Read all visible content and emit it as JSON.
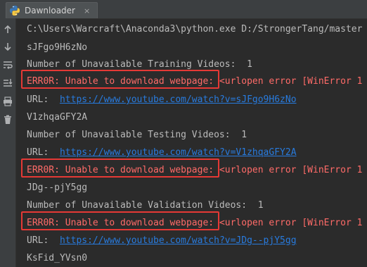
{
  "tab": {
    "title": "Dawnloader",
    "close_glyph": "×",
    "icon": "python-icon"
  },
  "toolbar": {
    "icons": [
      "arrow-up-icon",
      "arrow-down-icon",
      "soft-wrap-icon",
      "scroll-to-end-icon",
      "print-icon",
      "trash-icon"
    ]
  },
  "colors": {
    "background": "#2b2b2b",
    "text": "#bbbbbb",
    "error": "#ff6b68",
    "link": "#287bde",
    "highlight": "#e53935"
  },
  "console": {
    "command": "C:\\Users\\Warcraft\\Anaconda3\\python.exe D:/StrongerTang/master",
    "id1": "sJFgo9H6zNo",
    "unavailable_training": "Number of Unavailable Training Videos:  1",
    "error1_prefix": "ERR0R: Unable to download webpage: ",
    "error1_rest": "<urlopen error [WinError 1",
    "url_label_1": "URL:  ",
    "url1": "https://www.youtube.com/watch?v=sJFgo9H6zNo",
    "id2": "V1zhqaGFY2A",
    "unavailable_testing": "Number of Unavailable Testing Videos:  1",
    "url_label_2": "URL:  ",
    "url2": "https://www.youtube.com/watch?v=V1zhqaGFY2A",
    "error2_prefix": "ERR0R: Unable to download webpage: ",
    "error2_rest": "<urlopen error [WinError 1",
    "id3": "JDg--pjY5gg",
    "unavailable_validation": "Number of Unavailable Validation Videos:  1",
    "error3_prefix": "ERR0R: Unable to download webpage: ",
    "error3_rest": "<urlopen error [WinError 1",
    "url_label_3": "URL:  ",
    "url3": "https://www.youtube.com/watch?v=JDg--pjY5gg",
    "id4": "KsFid_YVsn0"
  }
}
